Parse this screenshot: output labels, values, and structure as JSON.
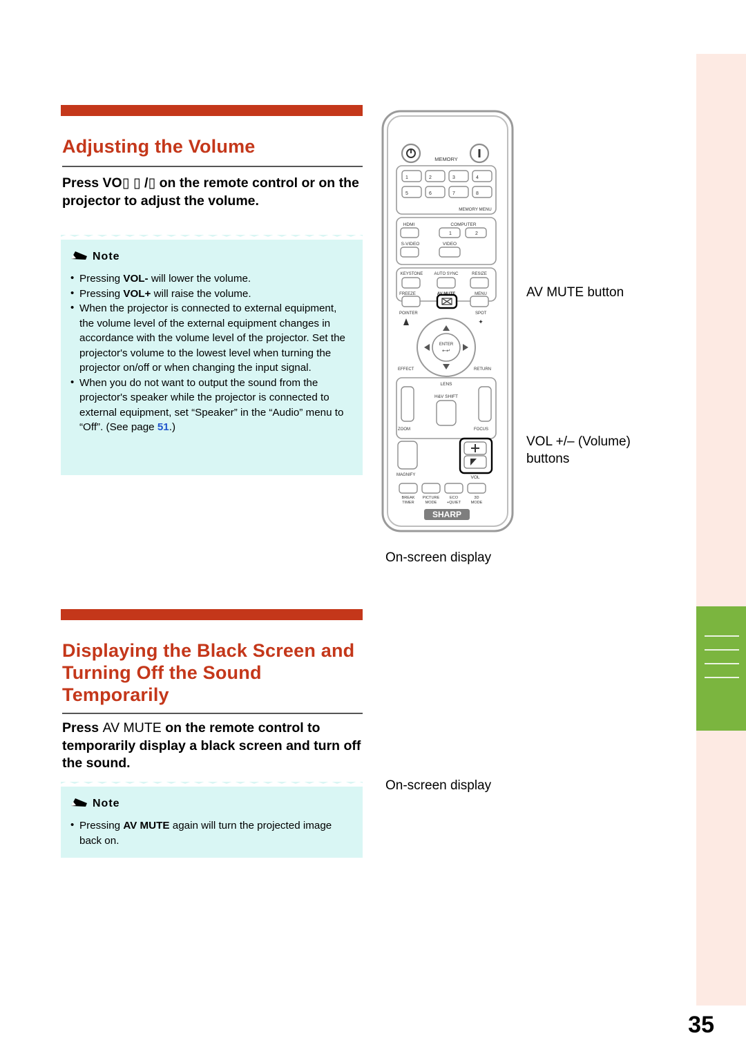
{
  "page": {
    "number": "35"
  },
  "section1": {
    "title": "Adjusting the Volume",
    "instruction_prefix": "Press VO",
    "instruction_symbols": "/",
    "instruction_rest": "on the remote control or on the projector to adjust the volume.",
    "note_label": "Note",
    "notes": [
      {
        "parts": [
          {
            "t": "Pressing "
          },
          {
            "t": "VOL-",
            "bold": true
          },
          {
            "t": " will lower the volume."
          }
        ]
      },
      {
        "parts": [
          {
            "t": "Pressing "
          },
          {
            "t": "VOL+",
            "bold": true
          },
          {
            "t": " will raise the volume."
          }
        ]
      },
      {
        "parts": [
          {
            "t": "When the projector is connected to external equipment, the volume level of the external equipment changes in accordance with the volume level of the projector. Set the projector's volume to the lowest level when turning the projector on/off or when changing the input signal."
          }
        ]
      },
      {
        "parts": [
          {
            "t": "When you do not want to output the sound from the projector's speaker while the projector is connected to external equipment, set “Speaker” in the “Audio” menu to “Off”. (See page "
          },
          {
            "t": "51",
            "page": true
          },
          {
            "t": ".)"
          }
        ]
      }
    ]
  },
  "section2": {
    "title": "Displaying the Black Screen and Turning Off the Sound Temporarily",
    "instruction_prefix": "Press ",
    "instruction_key": "AV MUTE",
    "instruction_rest": " on the remote control to temporarily display a black screen and turn off the sound.",
    "note_label": "Note",
    "notes": [
      {
        "parts": [
          {
            "t": "Pressing "
          },
          {
            "t": "AV MUTE",
            "bold": true
          },
          {
            "t": " again will turn the projected image back on."
          }
        ]
      }
    ]
  },
  "callouts": {
    "av_mute_button": "AV MUTE button",
    "vol_buttons_line1": "VOL +/– (Volume)",
    "vol_buttons_line2": "buttons",
    "onscreen_display_1": "On-screen display",
    "onscreen_display_2": "On-screen display"
  },
  "remote": {
    "brand": "SHARP",
    "labels": {
      "memory": "MEMORY",
      "memory_menu": "MEMORY MENU",
      "hdmi": "HDMI",
      "computer": "COMPUTER",
      "svideo": "S-VIDEO",
      "video": "VIDEO",
      "keystone": "KEYSTONE",
      "auto_sync": "AUTO SYNC",
      "resize": "RESIZE",
      "freeze": "FREEZE",
      "av_mute": "AV MUTE",
      "menu": "MENU",
      "pointer": "POINTER",
      "spot": "SPOT",
      "effect": "EFFECT",
      "return": "RETURN",
      "enter": "ENTER",
      "lens": "LENS",
      "hv_shift": "H&V SHIFT",
      "zoom": "ZOOM",
      "focus": "FOCUS",
      "magnify": "MAGNIFY",
      "vol": "VOL",
      "break_timer": "BREAK\nTIMER",
      "picture_mode": "PICTURE\nMODE",
      "eco_quiet": "ECO\n+QUIET",
      "three_d_mode": "3D\nMODE"
    },
    "numeric_keys": [
      "1",
      "2",
      "3",
      "4",
      "5",
      "6",
      "7",
      "8"
    ],
    "icons": {
      "power_on": "power-on-icon",
      "power_standby": "standby-icon",
      "av_mute": "av-mute-icon",
      "vol_plus": "plus-icon",
      "vol_minus": "minus-icon"
    }
  }
}
